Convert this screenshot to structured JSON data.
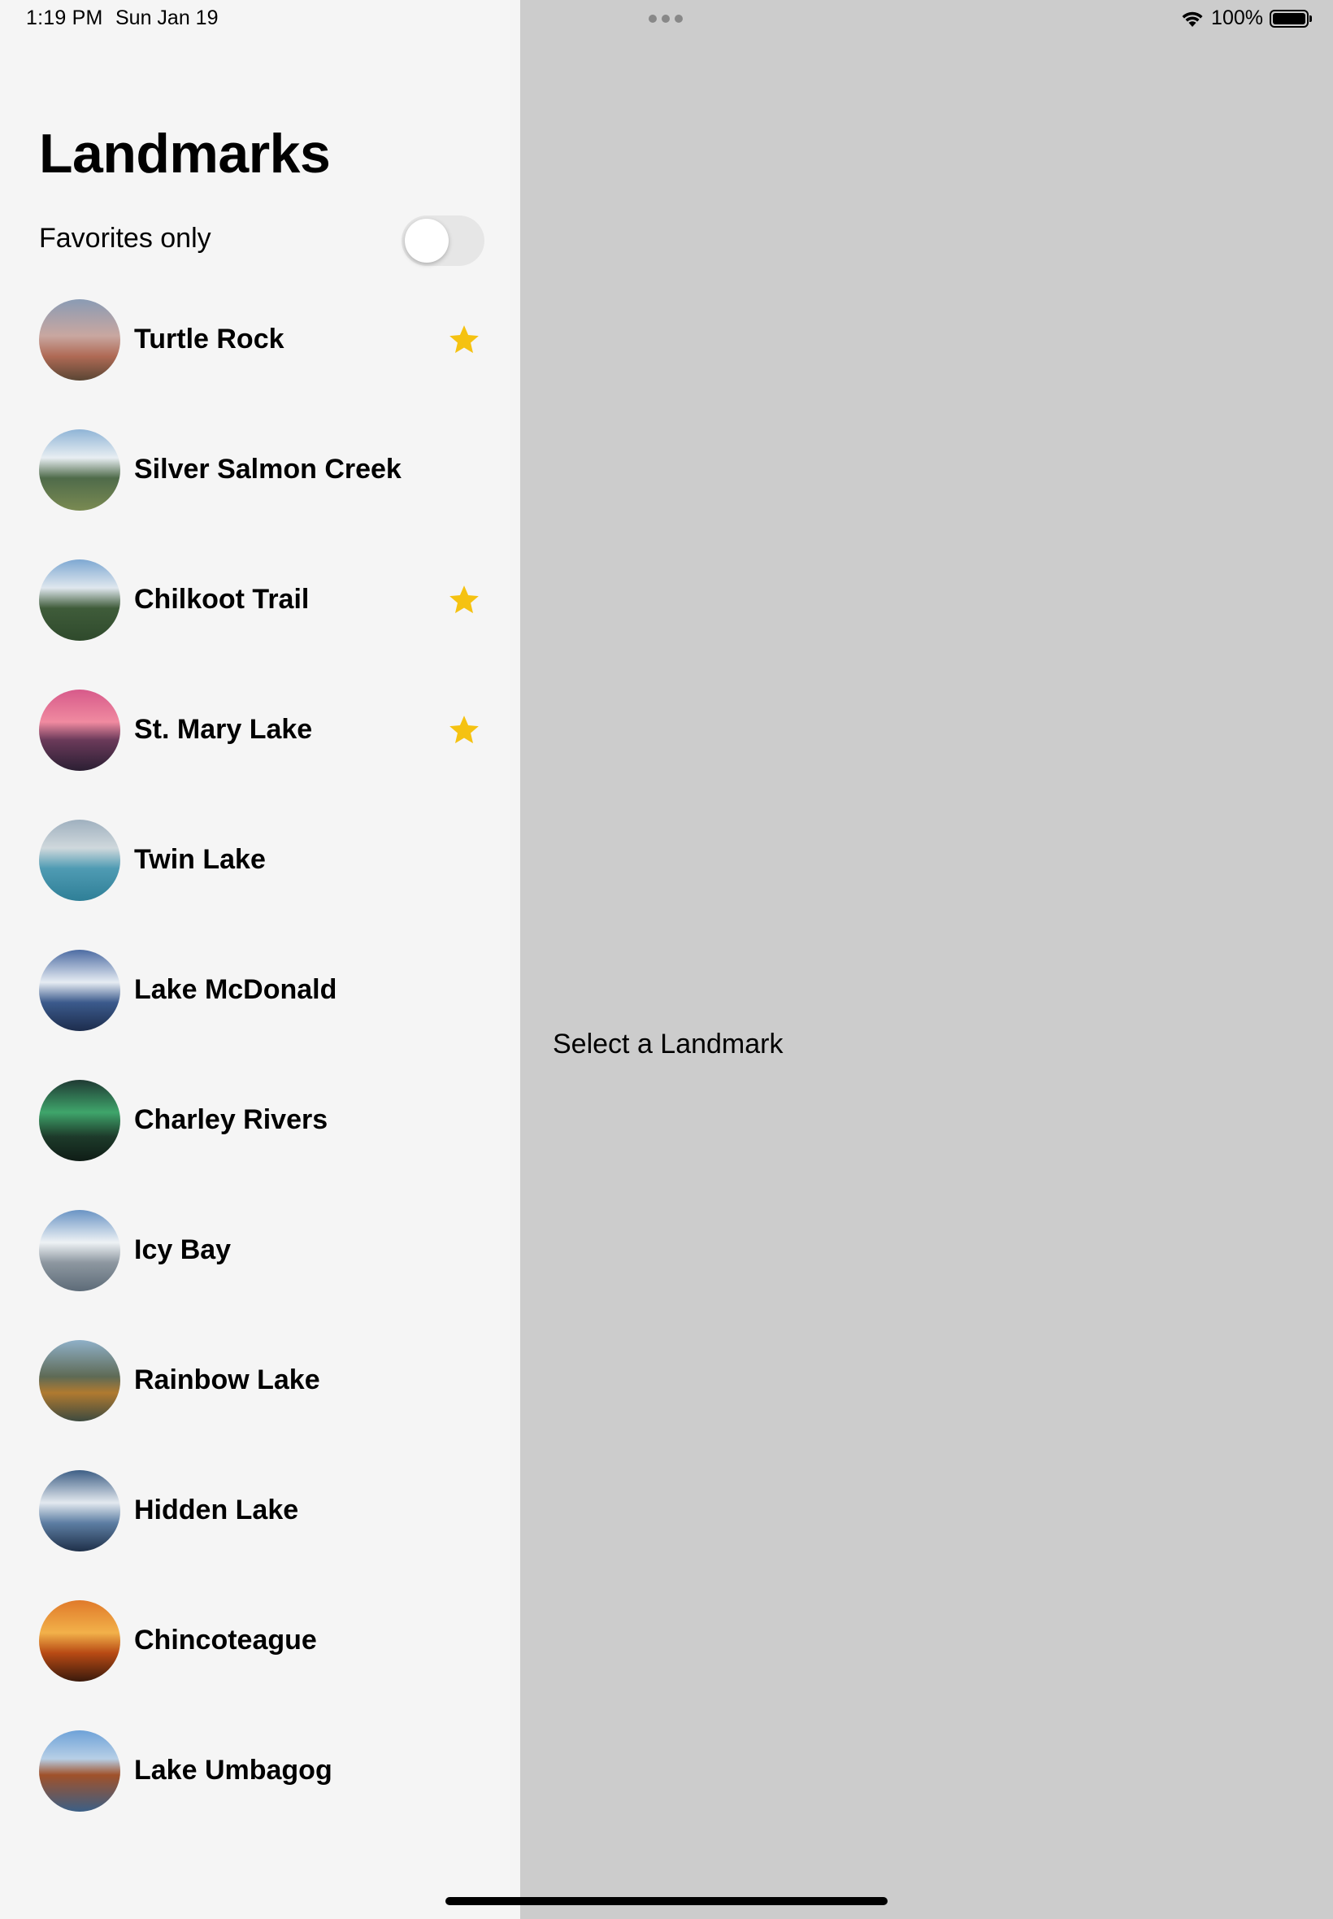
{
  "status_bar": {
    "time": "1:19 PM",
    "date": "Sun Jan 19",
    "battery": "100%",
    "icons": [
      "wifi-icon",
      "battery-icon"
    ]
  },
  "sidebar": {
    "title": "Landmarks",
    "favorites_toggle": {
      "label": "Favorites only",
      "on": false
    },
    "landmarks": [
      {
        "name": "Turtle Rock",
        "favorite": true
      },
      {
        "name": "Silver Salmon Creek",
        "favorite": false
      },
      {
        "name": "Chilkoot Trail",
        "favorite": true
      },
      {
        "name": "St. Mary Lake",
        "favorite": true
      },
      {
        "name": "Twin Lake",
        "favorite": false
      },
      {
        "name": "Lake McDonald",
        "favorite": false
      },
      {
        "name": "Charley Rivers",
        "favorite": false
      },
      {
        "name": "Icy Bay",
        "favorite": false
      },
      {
        "name": "Rainbow Lake",
        "favorite": false
      },
      {
        "name": "Hidden Lake",
        "favorite": false
      },
      {
        "name": "Chincoteague",
        "favorite": false
      },
      {
        "name": "Lake Umbagog",
        "favorite": false
      }
    ]
  },
  "detail": {
    "placeholder": "Select a Landmark"
  },
  "colors": {
    "star": "#f5c211",
    "sidebar_bg": "#f5f5f5",
    "detail_bg": "#cccccc"
  }
}
